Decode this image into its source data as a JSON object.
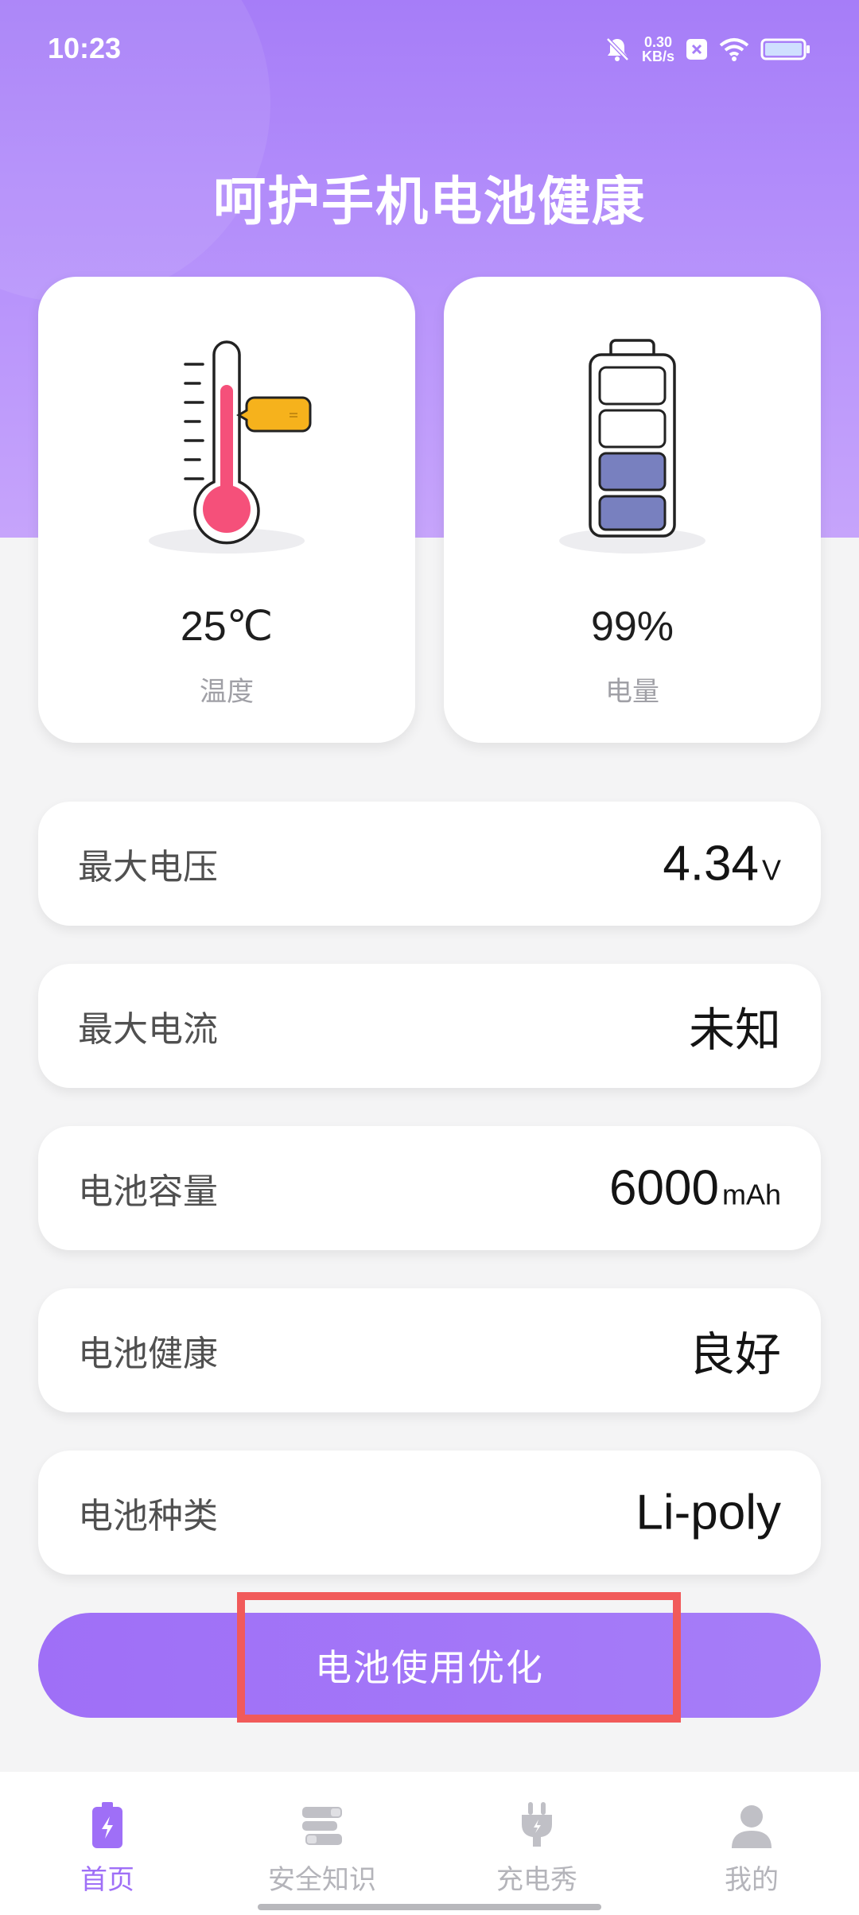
{
  "status_bar": {
    "time": "10:23",
    "net_speed_value": "0.30",
    "net_speed_unit": "KB/s"
  },
  "header": {
    "title": "呵护手机电池健康"
  },
  "cards": {
    "temperature": {
      "value": "25℃",
      "label": "温度",
      "icon": "thermometer-icon"
    },
    "charge": {
      "value": "99%",
      "label": "电量",
      "icon": "battery-level-icon"
    }
  },
  "rows": [
    {
      "label": "最大电压",
      "value": "4.34",
      "unit": "V"
    },
    {
      "label": "最大电流",
      "value": "未知",
      "unit": ""
    },
    {
      "label": "电池容量",
      "value": "6000",
      "unit": "mAh"
    },
    {
      "label": "电池健康",
      "value": "良好",
      "unit": ""
    },
    {
      "label": "电池种类",
      "value": "Li-poly",
      "unit": ""
    }
  ],
  "optimize_button": {
    "label": "电池使用优化"
  },
  "tabbar": [
    {
      "label": "首页",
      "icon": "battery-bolt-icon",
      "active": true
    },
    {
      "label": "安全知识",
      "icon": "books-icon",
      "active": false
    },
    {
      "label": "充电秀",
      "icon": "plug-icon",
      "active": false
    },
    {
      "label": "我的",
      "icon": "user-icon",
      "active": false
    }
  ],
  "colors": {
    "accent": "#9f6ff7",
    "thermometer_fill": "#f5507a",
    "battery_fill": "#7880bf",
    "highlight": "#f15a5a"
  }
}
